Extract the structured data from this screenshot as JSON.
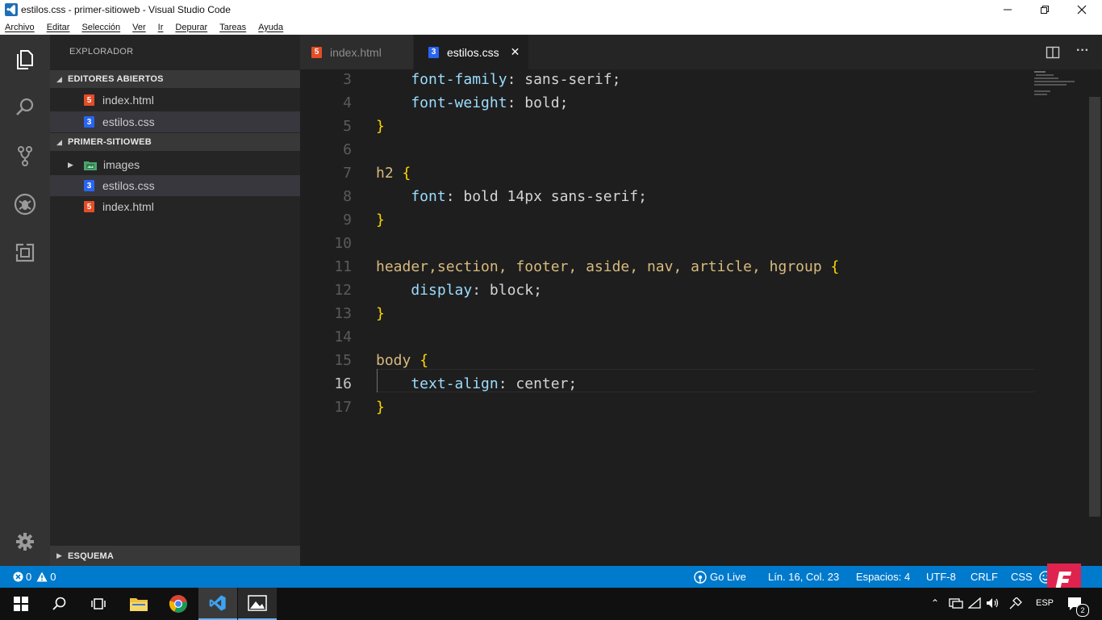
{
  "window": {
    "title": "estilos.css - primer-sitioweb - Visual Studio Code"
  },
  "menu": [
    "Archivo",
    "Editar",
    "Selección",
    "Ver",
    "Ir",
    "Depurar",
    "Tareas",
    "Ayuda"
  ],
  "sidebar": {
    "title": "EXPLORADOR",
    "open_editors": {
      "label": "EDITORES ABIERTOS",
      "items": [
        {
          "name": "index.html",
          "type": "html"
        },
        {
          "name": "estilos.css",
          "type": "css"
        }
      ]
    },
    "project": {
      "label": "PRIMER-SITIOWEB",
      "items": [
        {
          "name": "images",
          "type": "folder"
        },
        {
          "name": "estilos.css",
          "type": "css"
        },
        {
          "name": "index.html",
          "type": "html"
        }
      ]
    },
    "outline": {
      "label": "ESQUEMA"
    }
  },
  "tabs": [
    {
      "label": "index.html",
      "active": false
    },
    {
      "label": "estilos.css",
      "active": true
    }
  ],
  "editor": {
    "current_line": 16,
    "lines": [
      {
        "n": "3",
        "tokens": [
          [
            "prop",
            "    font-family"
          ],
          [
            "val",
            ": sans-serif;"
          ]
        ]
      },
      {
        "n": "4",
        "tokens": [
          [
            "prop",
            "    font-weight"
          ],
          [
            "val",
            ": bold;"
          ]
        ]
      },
      {
        "n": "5",
        "tokens": [
          [
            "brace",
            "}"
          ]
        ]
      },
      {
        "n": "6",
        "tokens": []
      },
      {
        "n": "7",
        "tokens": [
          [
            "sel",
            "h2 "
          ],
          [
            "brace",
            "{"
          ]
        ]
      },
      {
        "n": "8",
        "tokens": [
          [
            "prop",
            "    font"
          ],
          [
            "val",
            ": bold 14px sans-serif;"
          ]
        ]
      },
      {
        "n": "9",
        "tokens": [
          [
            "brace",
            "}"
          ]
        ]
      },
      {
        "n": "10",
        "tokens": []
      },
      {
        "n": "11",
        "tokens": [
          [
            "sel",
            "header,section, footer, aside, nav, article, hgroup "
          ],
          [
            "brace",
            "{"
          ]
        ]
      },
      {
        "n": "12",
        "tokens": [
          [
            "prop",
            "    display"
          ],
          [
            "val",
            ": block;"
          ]
        ]
      },
      {
        "n": "13",
        "tokens": [
          [
            "brace",
            "}"
          ]
        ]
      },
      {
        "n": "14",
        "tokens": []
      },
      {
        "n": "15",
        "tokens": [
          [
            "sel",
            "body "
          ],
          [
            "brace",
            "{"
          ]
        ]
      },
      {
        "n": "16",
        "tokens": [
          [
            "prop",
            "    text-align"
          ],
          [
            "val",
            ": center;"
          ]
        ]
      },
      {
        "n": "17",
        "tokens": [
          [
            "brace",
            "}"
          ]
        ]
      }
    ]
  },
  "statusbar": {
    "errors": "0",
    "warnings": "0",
    "go_live": "Go Live",
    "position": "Lín. 16, Col. 23",
    "spaces": "Espacios: 4",
    "encoding": "UTF-8",
    "eol": "CRLF",
    "language": "CSS"
  },
  "colors": {
    "statusbar": "#007acc",
    "activity_bar": "#333333",
    "sidebar": "#252526",
    "editor": "#1e1e1e",
    "selector": "#d7ba7d",
    "property": "#9cdcfe",
    "brace": "#ffd700"
  },
  "taskbar": {
    "icons": [
      "windows-start-icon",
      "search-icon",
      "task-view-icon",
      "file-explorer-icon",
      "chrome-icon",
      "vscode-icon",
      "photos-icon"
    ],
    "language_indicator": "ESP",
    "notification_count": "2"
  }
}
